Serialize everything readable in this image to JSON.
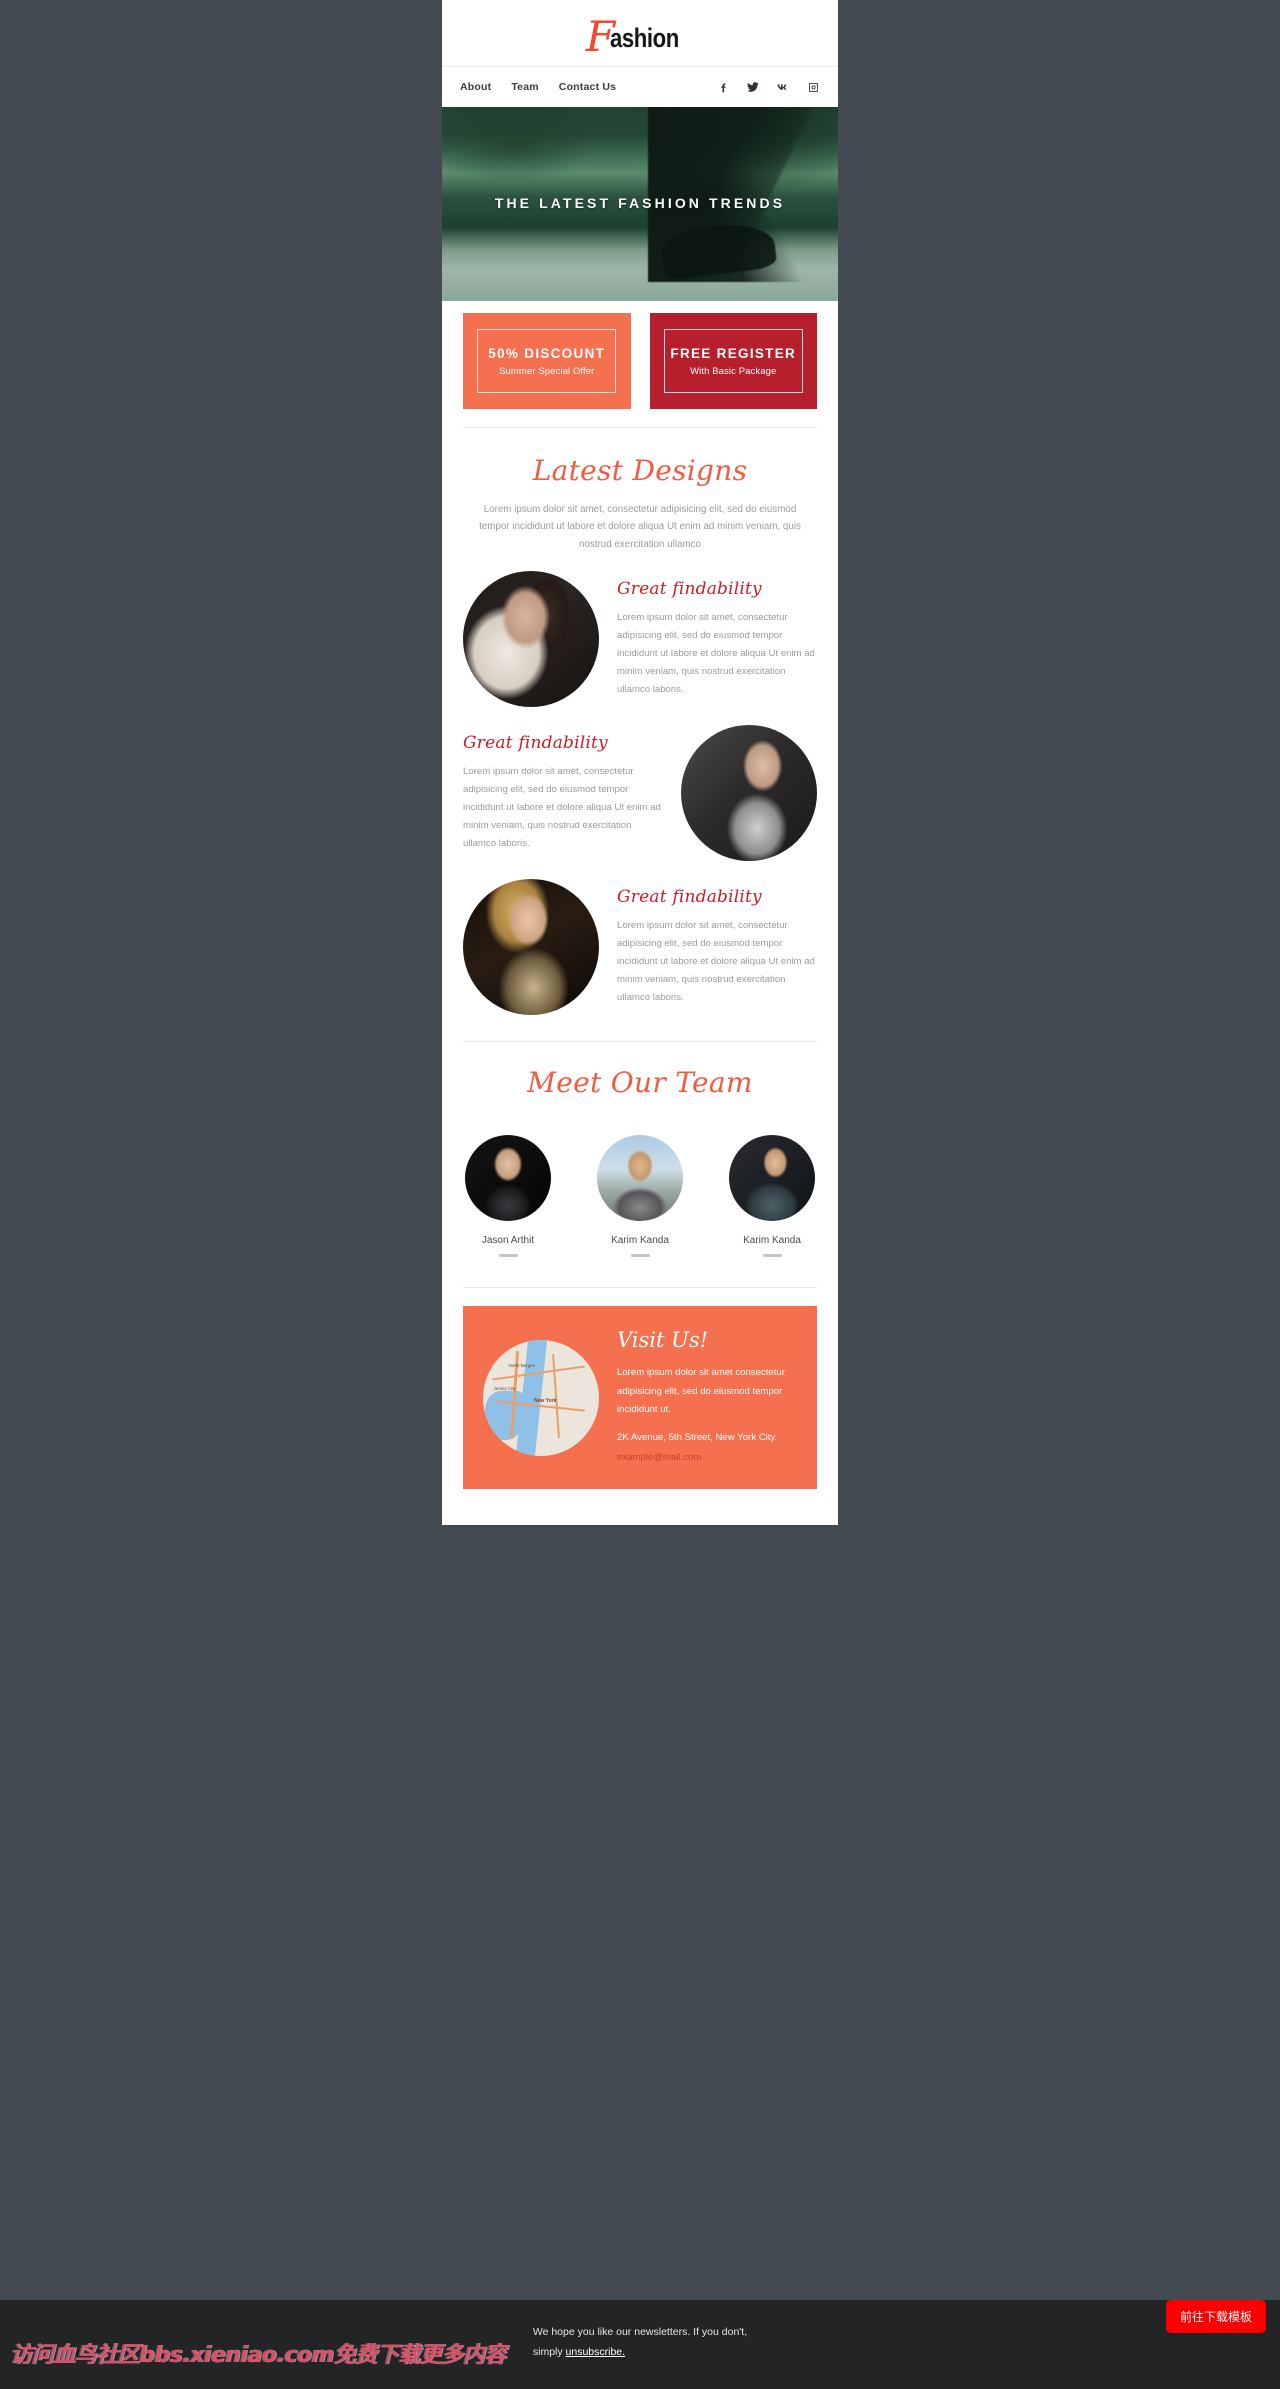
{
  "page": {
    "background_color": "#434a52",
    "card_background": "#ffffff",
    "accent_coral": "#f4704f",
    "accent_red": "#cc1c27",
    "accent_crimson": "#b81f2d"
  },
  "brand": {
    "initial": "F",
    "rest": "ashion"
  },
  "nav": {
    "links": [
      {
        "label": "About"
      },
      {
        "label": "Team"
      },
      {
        "label": "Contact Us"
      }
    ],
    "social": [
      {
        "name": "facebook-icon"
      },
      {
        "name": "twitter-icon"
      },
      {
        "name": "vk-icon"
      },
      {
        "name": "instagram-icon"
      }
    ]
  },
  "hero": {
    "title": "THE LATEST FASHION TRENDS"
  },
  "offers": [
    {
      "title": "50% DISCOUNT",
      "subtitle": "Summer Special Offer",
      "background": "#f4704f"
    },
    {
      "title": "FREE REGISTER",
      "subtitle": "With Basic Package",
      "background": "#b81f2d"
    }
  ],
  "designs": {
    "title": "Latest Designs",
    "lead": "Lorem ipsum dolor sit amet, consectetur adipisicing elit, sed do eiusmod tempor incididunt ut labore et dolore aliqua Ut enim ad minim veniam, quis nostrud exercitation ullamco",
    "features": [
      {
        "title": "Great findability",
        "text": "Lorem ipsum dolor sit amet, consectetur adipisicing elit, sed do eiusmod tempor incididunt ut labore et dolore aliqua Ut enim ad minim veniam, quis nostrud exercitation ullamco laboris.",
        "image": "woman-in-black-photo"
      },
      {
        "title": "Great findability",
        "text": "Lorem ipsum dolor sit amet, consectetur adipisicing elit, sed do eiusmod tempor incididunt ut labore et dolore aliqua Ut enim ad minim veniam, quis nostrud exercitation ullamco laboris.",
        "image": "man-with-sunglasses-photo"
      },
      {
        "title": "Great findability",
        "text": "Lorem ipsum dolor sit amet, consectetur adipisicing elit, sed do eiusmod tempor incididunt ut labore et dolore aliqua Ut enim ad minim veniam, quis nostrud exercitation ullamco laboris.",
        "image": "blonde-woman-photo"
      }
    ]
  },
  "team": {
    "title": "Meet Our Team",
    "members": [
      {
        "name": "Jason Arthit",
        "photo": "bald-man-suit-photo"
      },
      {
        "name": "Karim Kanda",
        "photo": "smiling-man-city-photo"
      },
      {
        "name": "Karim Kanda",
        "photo": "man-glasses-photo"
      }
    ]
  },
  "visit": {
    "title": "Visit Us!",
    "text": "Lorem ipsum dolor sit amet consectetur adipisicing elit, sed do eiusmod tempor incididunt ut.",
    "address": "2K Avenue, 5th Street, New York City.",
    "email": "example@mail.com",
    "map": {
      "city_label": "New York",
      "labels": [
        "Jersey City",
        "North Bergen"
      ]
    }
  },
  "footer": {
    "line1": "We hope you like our newsletters. If you don't,",
    "line2_prefix": "simply ",
    "link": "unsubscribe."
  },
  "overlay": {
    "watermark": "访问血鸟社区bbs.xieniao.com免费下载更多内容",
    "download_button": "前往下载模板"
  }
}
